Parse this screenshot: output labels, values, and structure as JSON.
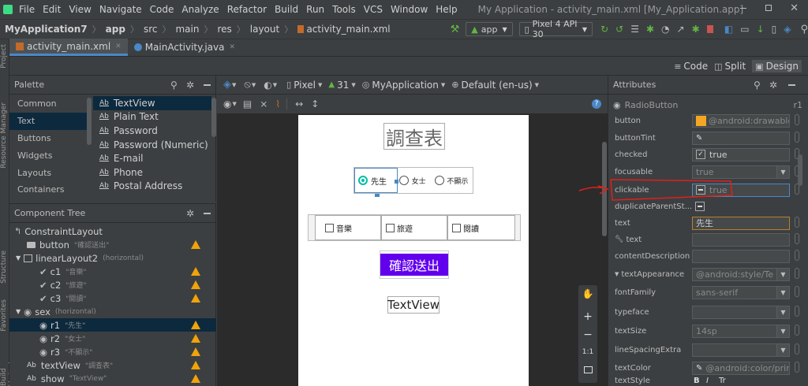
{
  "menu": {
    "items": [
      "File",
      "Edit",
      "View",
      "Navigate",
      "Code",
      "Analyze",
      "Refactor",
      "Build",
      "Run",
      "Tools",
      "VCS",
      "Window",
      "Help"
    ],
    "title": "My Application - activity_main.xml [My_Application.app]"
  },
  "nav": {
    "breadcrumbs": [
      "MyApplication7",
      "app",
      "src",
      "main",
      "res",
      "layout",
      "activity_main.xml"
    ],
    "run_config": "app",
    "device": "Pixel 4 API 30"
  },
  "editor_tabs": [
    "activity_main.xml",
    "MainActivity.java"
  ],
  "view_modes": {
    "code": "Code",
    "split": "Split",
    "design": "Design"
  },
  "side_tools": [
    "Project",
    "Resource Manager",
    "Structure",
    "Favorites",
    "Build Variants"
  ],
  "palette": {
    "title": "Palette",
    "categories": [
      "Common",
      "Text",
      "Buttons",
      "Widgets",
      "Layouts",
      "Containers"
    ],
    "items": [
      "TextView",
      "Plain Text",
      "Password",
      "Password (Numeric)",
      "E-mail",
      "Phone",
      "Postal Address"
    ],
    "ab": "Ab"
  },
  "component_tree": {
    "title": "Component Tree",
    "nodes": [
      {
        "id": "ConstraintLayout",
        "sub": ""
      },
      {
        "id": "button",
        "sub": "\"確認送出\""
      },
      {
        "id": "linearLayout2",
        "sub": "(horizontal)"
      },
      {
        "id": "c1",
        "sub": "\"音樂\""
      },
      {
        "id": "c2",
        "sub": "\"旅遊\""
      },
      {
        "id": "c3",
        "sub": "\"閱讀\""
      },
      {
        "id": "sex",
        "sub": "(horizontal)"
      },
      {
        "id": "r1",
        "sub": "\"先生\""
      },
      {
        "id": "r2",
        "sub": "\"女士\""
      },
      {
        "id": "r3",
        "sub": "\"不顯示\""
      },
      {
        "id": "textView",
        "sub": "\"調查表\""
      },
      {
        "id": "show",
        "sub": "\"TextView\""
      }
    ]
  },
  "design_toolbar": {
    "device": "Pixel",
    "api": "31",
    "app": "MyApplication",
    "locale": "Default (en-us)"
  },
  "preview": {
    "title": "調查表",
    "radios": [
      "先生",
      "女士",
      "不顯示"
    ],
    "checks": [
      "音樂",
      "旅遊",
      "閱讀"
    ],
    "button": "確認送出",
    "textview": "TextView"
  },
  "zoom_controls": {
    "plus": "+",
    "minus": "−",
    "ratio": "1:1"
  },
  "attributes": {
    "title": "Attributes",
    "widget": "RadioButton",
    "id": "r1",
    "rows": [
      {
        "name": "button",
        "value": "@android:drawable/"
      },
      {
        "name": "buttonTint",
        "value": ""
      },
      {
        "name": "checked",
        "value": "true"
      },
      {
        "name": "focusable",
        "value": "true"
      },
      {
        "name": "clickable",
        "value": "true"
      },
      {
        "name": "duplicateParentSt...",
        "value": ""
      },
      {
        "name": "text",
        "value": "先生"
      },
      {
        "name": "text",
        "value": ""
      },
      {
        "name": "contentDescription",
        "value": ""
      },
      {
        "name": "textAppearance",
        "value": "@android:style/Te"
      },
      {
        "name": "fontFamily",
        "value": "sans-serif"
      },
      {
        "name": "typeface",
        "value": ""
      },
      {
        "name": "textSize",
        "value": "14sp"
      },
      {
        "name": "lineSpacingExtra",
        "value": ""
      },
      {
        "name": "textColor",
        "value": "@android:color/prin"
      },
      {
        "name": "textStyle",
        "value": ""
      }
    ],
    "text_style_buttons": [
      "B",
      "I",
      "Tr"
    ]
  },
  "colors": {
    "accent": "#4a88c7",
    "button_purple": "#6200ee",
    "warn": "#f0a30a",
    "selection": "#0d293e",
    "annotation_red": "#e0201a",
    "button_swatch": "#f5a623"
  }
}
